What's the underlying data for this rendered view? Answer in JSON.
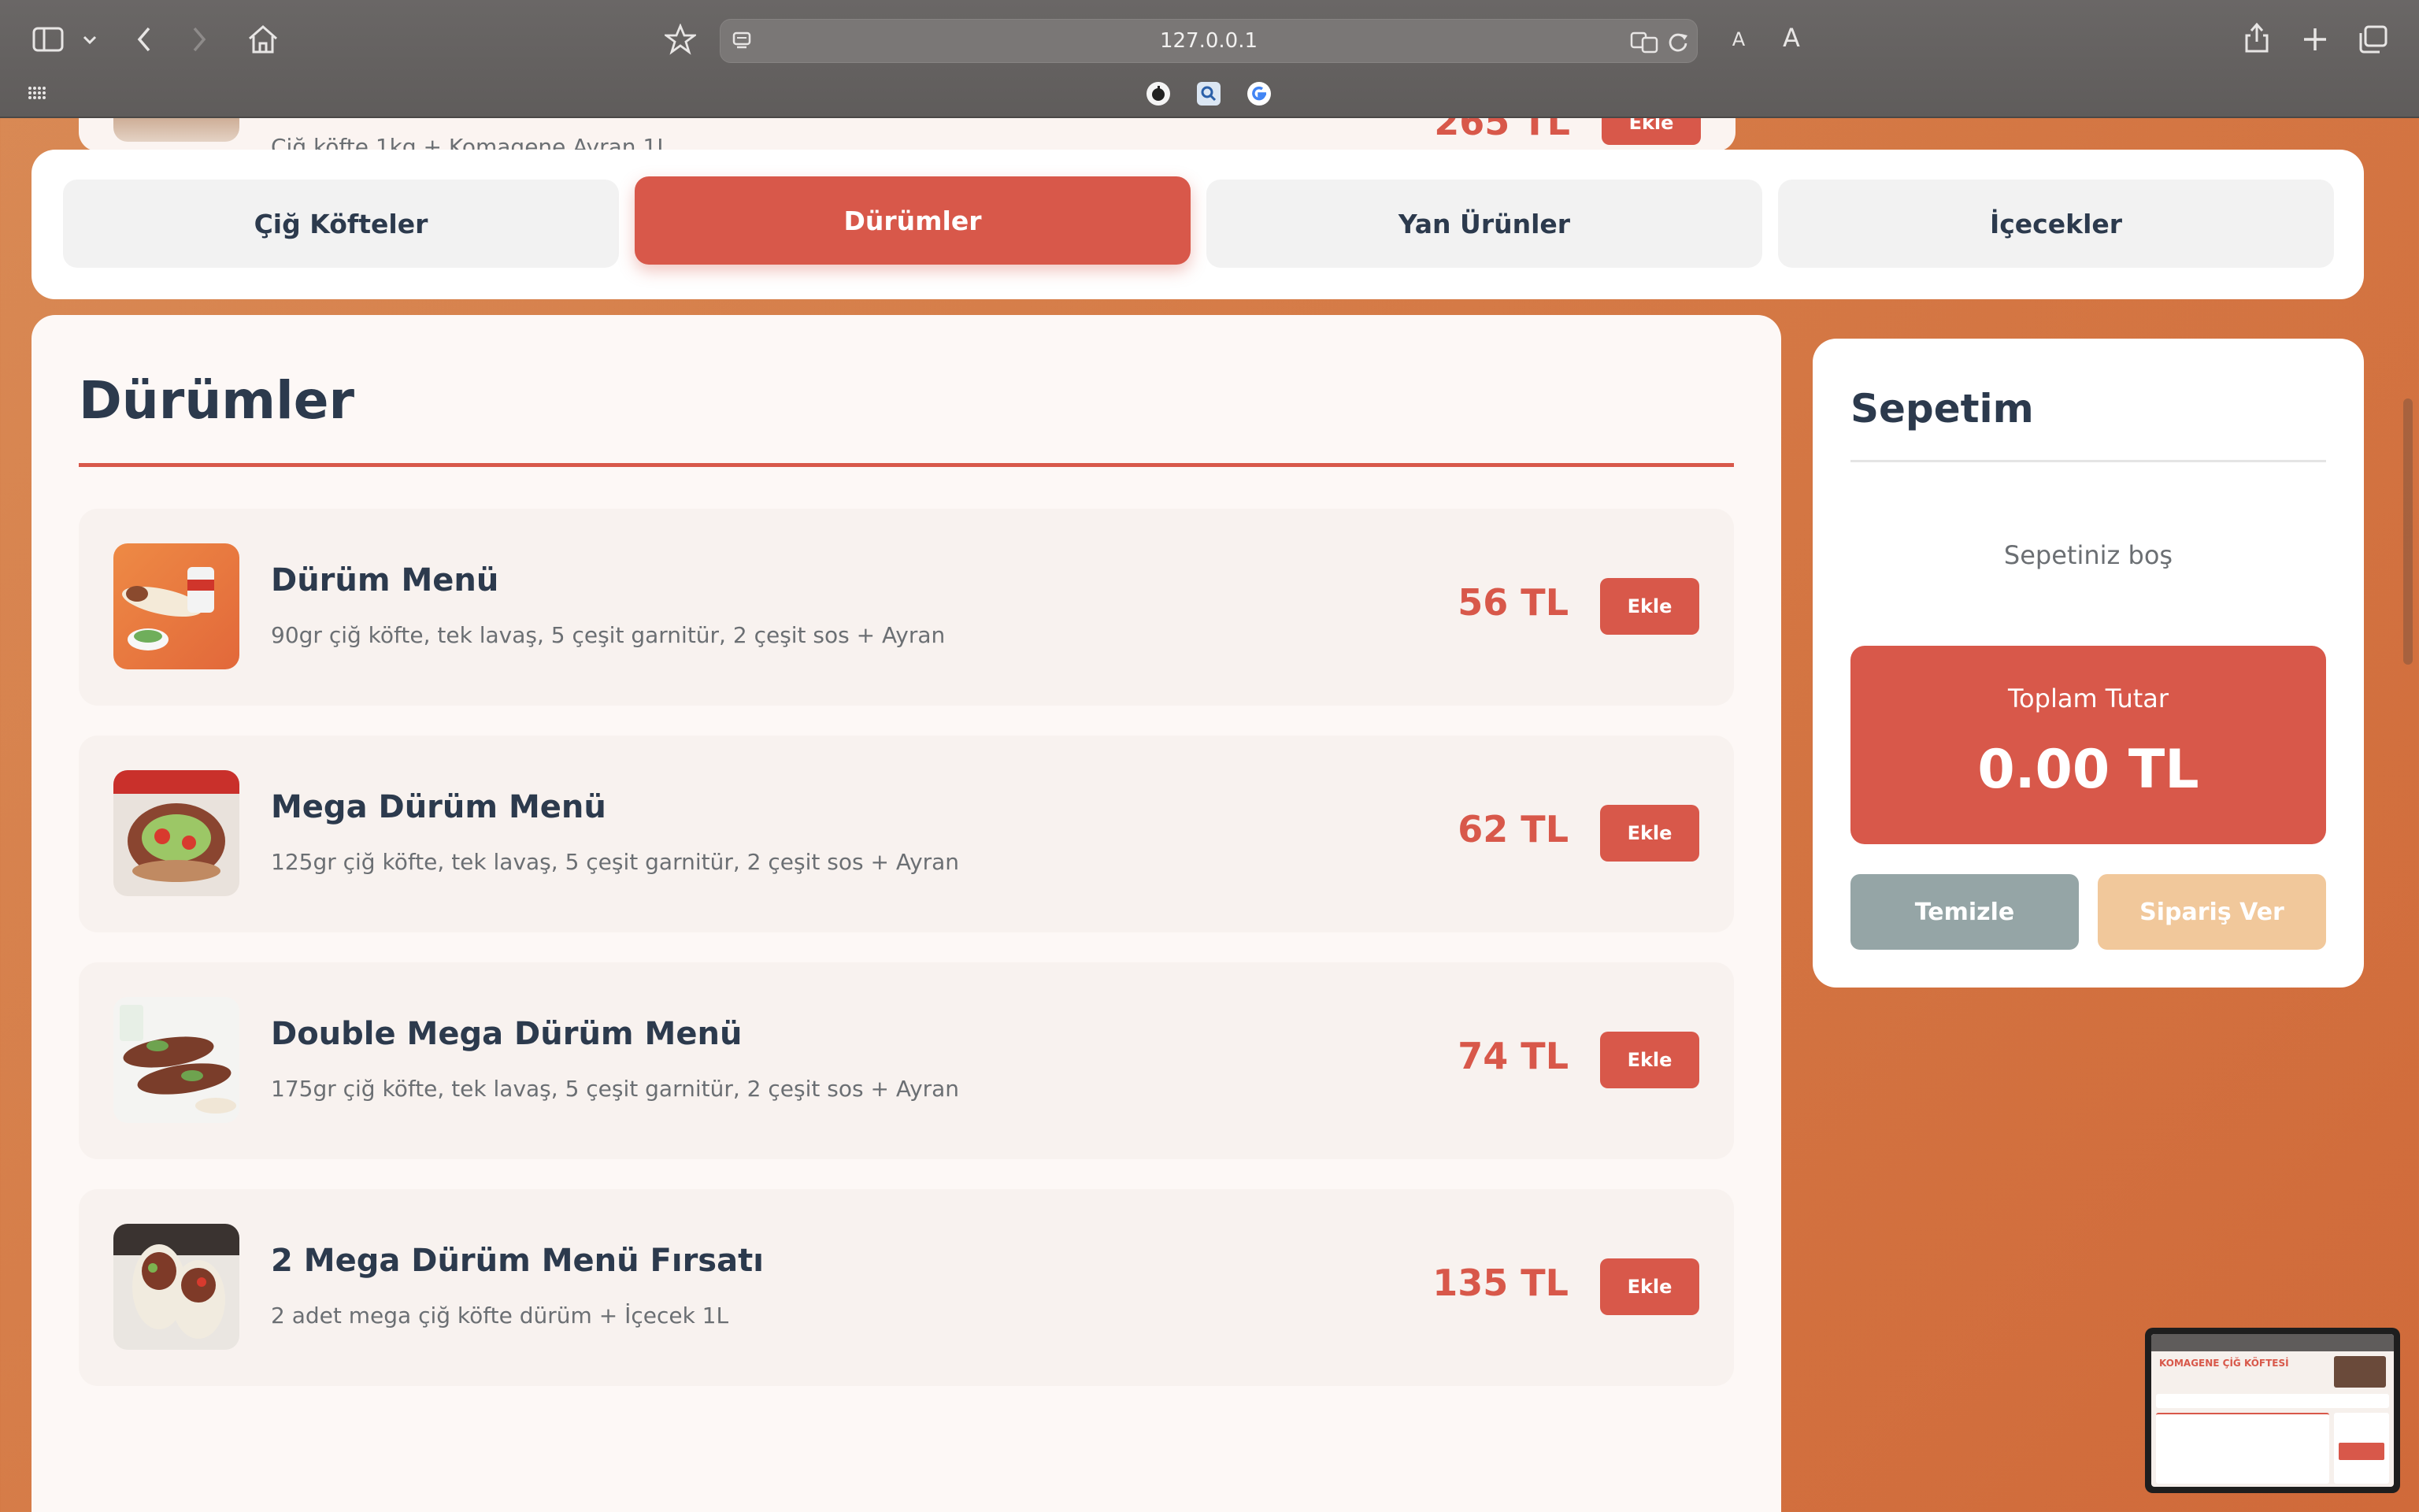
{
  "browser": {
    "url": "127.0.0.1",
    "buttons": {
      "sidebar": "sidebar-toggle",
      "back": "back",
      "forward": "forward",
      "home": "home",
      "bookmark": "star",
      "share": "share",
      "new_tab": "plus",
      "tabs": "tabs"
    },
    "text_small": "A",
    "text_large": "A"
  },
  "peek": {
    "desc": "Çiğ köfte 1kg + Komagene Ayran 1L",
    "price": "265 TL",
    "add": "Ekle"
  },
  "tabs": [
    {
      "label": "Çiğ Köfteler",
      "active": false
    },
    {
      "label": "Dürümler",
      "active": true
    },
    {
      "label": "Yan Ürünler",
      "active": false
    },
    {
      "label": "İçecekler",
      "active": false
    }
  ],
  "menu": {
    "title": "Dürümler",
    "items": [
      {
        "name": "Dürüm Menü",
        "desc": "90gr çiğ köfte, tek lavaş, 5 çeşit garnitür, 2 çeşit sos + Ayran",
        "price": "56 TL",
        "add": "Ekle"
      },
      {
        "name": "Mega Dürüm Menü",
        "desc": "125gr çiğ köfte, tek lavaş, 5 çeşit garnitür, 2 çeşit sos + Ayran",
        "price": "62 TL",
        "add": "Ekle"
      },
      {
        "name": "Double Mega Dürüm Menü",
        "desc": "175gr çiğ köfte, tek lavaş, 5 çeşit garnitür, 2 çeşit sos + Ayran",
        "price": "74 TL",
        "add": "Ekle"
      },
      {
        "name": "2 Mega Dürüm Menü Fırsatı",
        "desc": "2 adet mega çiğ köfte dürüm + İçecek 1L",
        "price": "135 TL",
        "add": "Ekle"
      }
    ]
  },
  "cart": {
    "title": "Sepetim",
    "empty": "Sepetiniz boş",
    "total_label": "Toplam Tutar",
    "total_value": "0.00 TL",
    "clear": "Temizle",
    "order": "Sipariş Ver"
  },
  "mini_preview": {
    "title": "KOMAGENE ÇİĞ KÖFTESİ"
  },
  "colors": {
    "accent": "#d8584a",
    "dark_text": "#2c3a4d",
    "muted_text": "#6b6f73",
    "clear_button": "#95a5a6",
    "order_button": "#f1c89b"
  }
}
